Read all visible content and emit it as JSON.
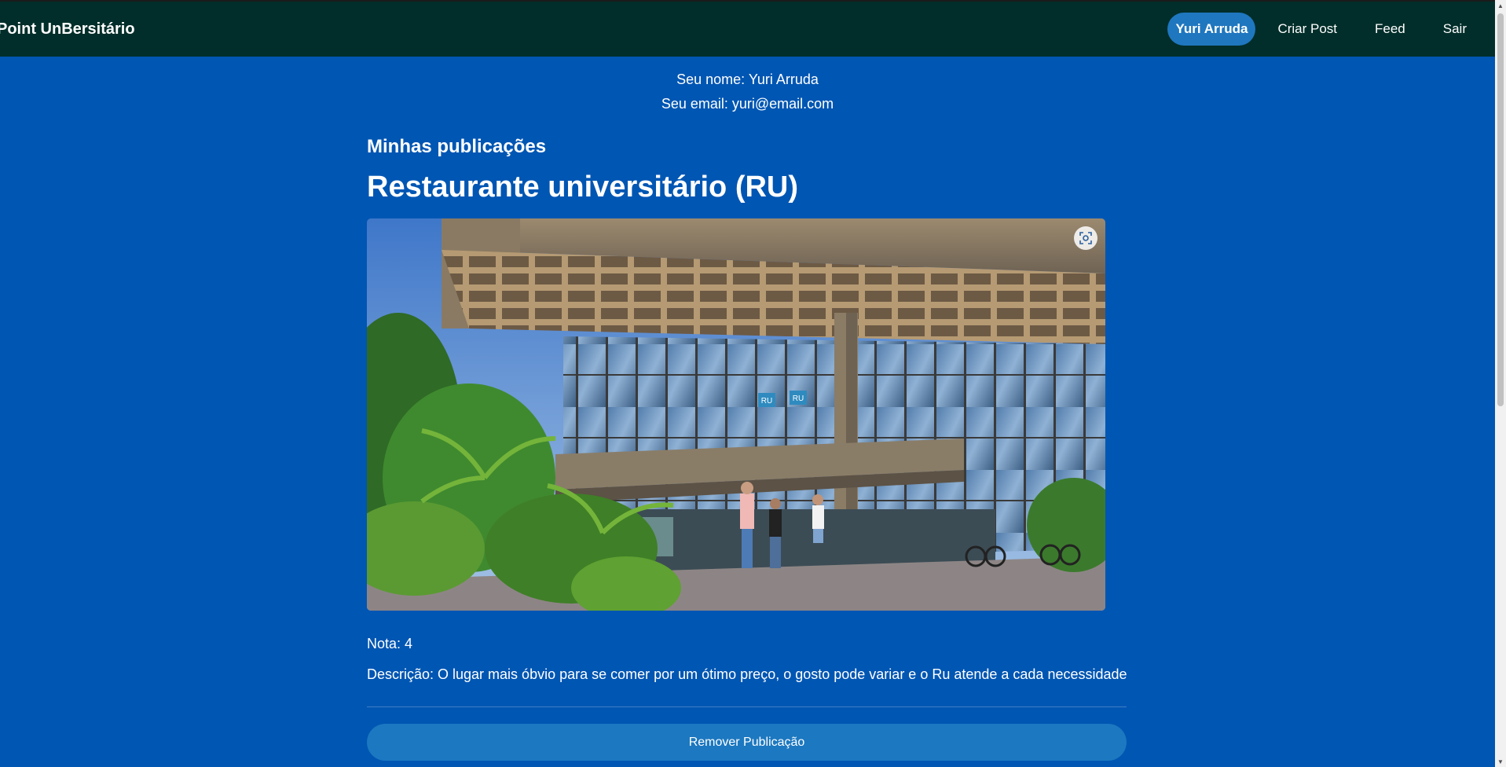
{
  "nav": {
    "brand": "Point UnBersitário",
    "links": [
      {
        "label": "Yuri Arruda",
        "active": true
      },
      {
        "label": "Criar Post",
        "active": false
      },
      {
        "label": "Feed",
        "active": false
      },
      {
        "label": "Sair",
        "active": false
      }
    ]
  },
  "profile": {
    "name_line": "Seu nome: Yuri Arruda",
    "email_line": "Seu email: yuri@email.com"
  },
  "section": {
    "title": "Minhas publicações"
  },
  "post": {
    "title": "Restaurante universitário (RU)",
    "image_icon": "image-search-icon",
    "rating_line": "Nota: 4",
    "description_line": "Descrição: O lugar mais óbvio para se comer por um ótimo preço, o gosto pode variar e o Ru atende a cada necessidade",
    "remove_button": "Remover Publicação",
    "sign_labels": [
      "RU",
      "RU"
    ]
  },
  "colors": {
    "navbar": "#012e2a",
    "page_background": "#0056b3",
    "accent_button": "#1c78c0"
  }
}
